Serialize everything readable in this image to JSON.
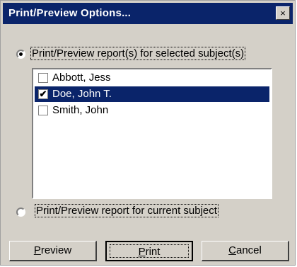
{
  "dialog": {
    "title": "Print/Preview Options...",
    "close_glyph": "×"
  },
  "option_selected": {
    "label": "Print/Preview report(s) for selected subject(s)",
    "checked": true
  },
  "subjects": [
    {
      "label": "Abbott, Jess",
      "checked": false,
      "selected": false
    },
    {
      "label": "Doe, John T.",
      "checked": true,
      "selected": true
    },
    {
      "label": "Smith, John",
      "checked": false,
      "selected": false
    }
  ],
  "option_current": {
    "label": "Print/Preview report for current subject",
    "checked": false
  },
  "buttons": {
    "preview": {
      "mnemonic": "P",
      "rest": "review"
    },
    "print": {
      "mnemonic": "P",
      "rest": "rint"
    },
    "cancel": {
      "mnemonic": "C",
      "rest": "ancel"
    }
  },
  "colors": {
    "title_bar": "#0a246a",
    "face": "#d4d0c8",
    "selection": "#0a246a"
  }
}
